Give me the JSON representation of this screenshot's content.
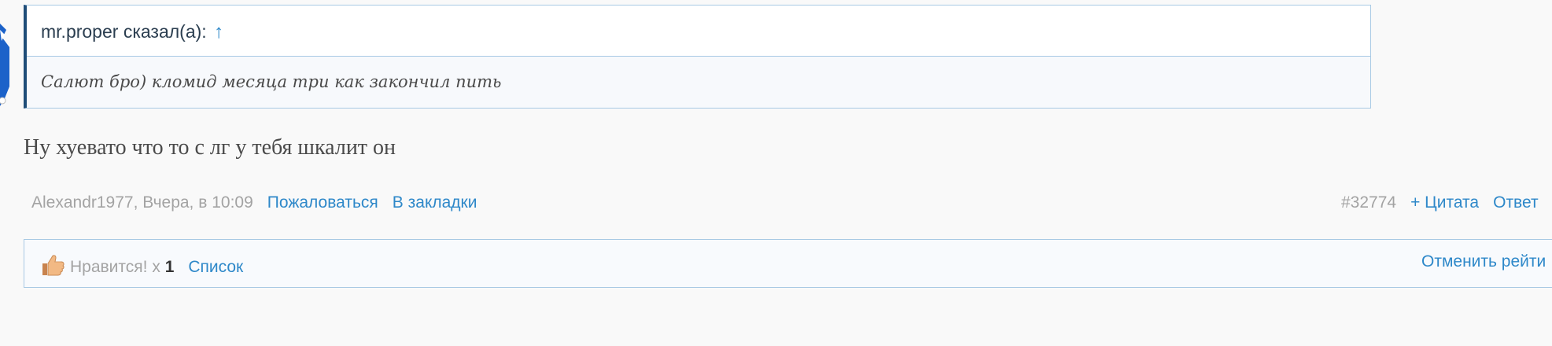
{
  "quote": {
    "author": "mr.proper сказал(а):",
    "arrow": "↑",
    "text": "Салют бро) кломид месяца три как закончил пить"
  },
  "post": {
    "body": "Ну хуевато что то с лг у тебя шкалит он",
    "author_time": "Alexandr1977, Вчера, в 10:09",
    "report_label": "Пожаловаться",
    "bookmark_label": "В закладки",
    "post_number": "#32774",
    "quote_label": "+ Цитата",
    "reply_label": "Ответ"
  },
  "likes": {
    "label": "Нравится!",
    "times": "x",
    "count": "1",
    "list_label": "Список",
    "unrate_label": "Отменить рейти"
  },
  "colors": {
    "link": "#2e88c9",
    "border": "#a8c9e4",
    "quote_accent": "#1f4d78",
    "background": "#f9f9f9"
  },
  "icons": {
    "like": "thumbs-up-icon",
    "avatar": "avatar-fragment"
  }
}
